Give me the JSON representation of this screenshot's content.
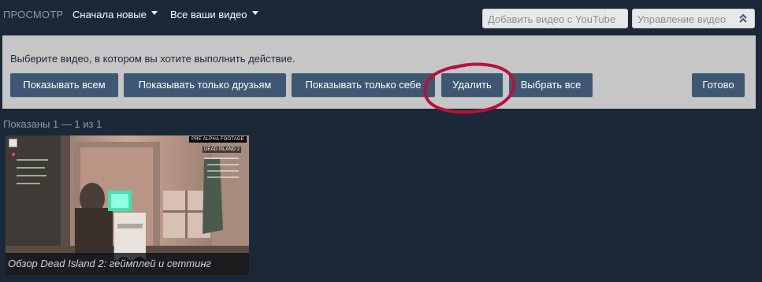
{
  "toolbar": {
    "view_label": "ПРОСМОТР",
    "sort_label": "Сначала новые",
    "filter_label": "Все ваши видео",
    "add_youtube_label": "Добавить видео с YouTube",
    "manage_label": "Управление видео"
  },
  "panel": {
    "instruction": "Выберите видео, в котором вы хотите выполнить действие.",
    "buttons": [
      "Показывать всем",
      "Показывать только друзьям",
      "Показывать только себе",
      "Удалить",
      "Выбрать все",
      "Готово"
    ]
  },
  "results": {
    "shown_text": "Показаны 1 — 1 из 1",
    "videos": [
      {
        "title": "Обзор Dead Island 2: геймплей и сеттинг",
        "badge": "PRE ALPHA FOOTAGE",
        "overlay_label": "DEAD ISLAND 2"
      }
    ]
  },
  "colors": {
    "background": "#1b2838",
    "panel": "#c6c6c6",
    "button": "#3e5873",
    "highlight": "#b5123f"
  },
  "icons": {
    "dropdown": "caret-down-icon",
    "manage": "double-chevron-up-icon",
    "annotation": "hand-drawn-circle"
  }
}
